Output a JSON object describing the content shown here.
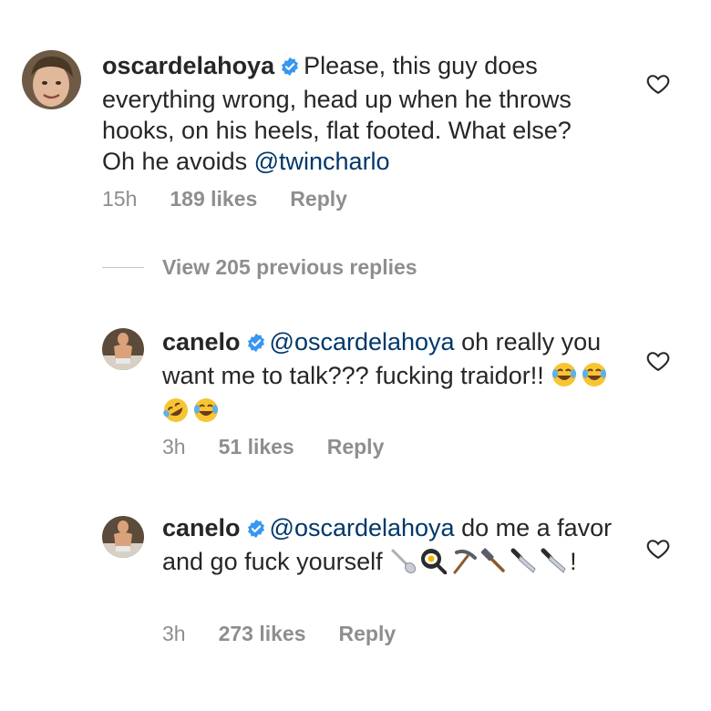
{
  "comments": [
    {
      "username": "oscardelahoya",
      "text": "Please, this guy does everything wrong, head up when he throws hooks, on his heels, flat footed. What else? Oh he avoids ",
      "mention": "@twincharlo",
      "time": "15h",
      "likes": "189 likes",
      "reply": "Reply"
    },
    {
      "username": "canelo",
      "mention": "@oscardelahoya",
      "text": " oh really you want me to talk??? fucking traidor!! ",
      "emojis": [
        "joy-emoji",
        "joy-emoji",
        "rofl-emoji",
        "joy-emoji"
      ],
      "time": "3h",
      "likes": "51 likes",
      "reply": "Reply"
    },
    {
      "username": "canelo",
      "mention": "@oscardelahoya",
      "text": "  do me a favor and go fuck yourself ",
      "emojis": [
        "spoon-emoji",
        "frying-pan-emoji",
        "pick-emoji",
        "hammer-emoji",
        "knife-emoji",
        "knife-emoji"
      ],
      "suffix": "!",
      "time": "3h",
      "likes": "273 likes",
      "reply": "Reply"
    }
  ],
  "view_replies": "View 205 previous replies",
  "colors": {
    "text": "#262626",
    "muted": "#8e8e8e",
    "mention": "#00376b",
    "verified": "#3897f0"
  }
}
